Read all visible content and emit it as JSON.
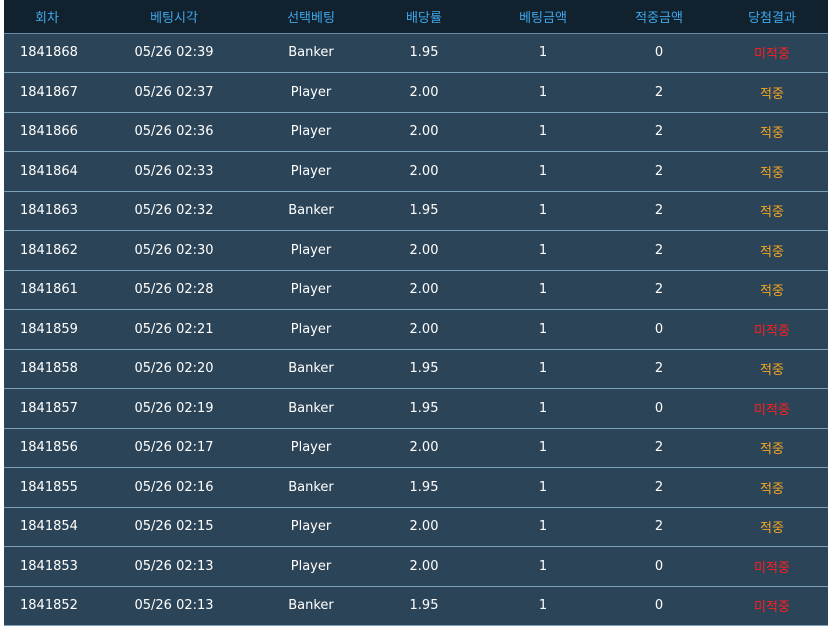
{
  "headers": [
    "회차",
    "베팅시각",
    "선택베팅",
    "배당률",
    "베팅금액",
    "적중금액",
    "당첨결과"
  ],
  "colors": {
    "header_bg": "#11212e",
    "header_text": "#3ea7ea",
    "row_bg": "#2c4457",
    "row_text": "#ffffff",
    "lose": "#ff1f1f",
    "win": "#f5a623"
  },
  "rows": [
    {
      "round": "1841868",
      "time": "05/26 02:39",
      "pick": "Banker",
      "odds": "1.95",
      "bet": "1",
      "payout": "0",
      "result": "미적중",
      "status": "lose"
    },
    {
      "round": "1841867",
      "time": "05/26 02:37",
      "pick": "Player",
      "odds": "2.00",
      "bet": "1",
      "payout": "2",
      "result": "적중",
      "status": "win"
    },
    {
      "round": "1841866",
      "time": "05/26 02:36",
      "pick": "Player",
      "odds": "2.00",
      "bet": "1",
      "payout": "2",
      "result": "적중",
      "status": "win"
    },
    {
      "round": "1841864",
      "time": "05/26 02:33",
      "pick": "Player",
      "odds": "2.00",
      "bet": "1",
      "payout": "2",
      "result": "적중",
      "status": "win"
    },
    {
      "round": "1841863",
      "time": "05/26 02:32",
      "pick": "Banker",
      "odds": "1.95",
      "bet": "1",
      "payout": "2",
      "result": "적중",
      "status": "win"
    },
    {
      "round": "1841862",
      "time": "05/26 02:30",
      "pick": "Player",
      "odds": "2.00",
      "bet": "1",
      "payout": "2",
      "result": "적중",
      "status": "win"
    },
    {
      "round": "1841861",
      "time": "05/26 02:28",
      "pick": "Player",
      "odds": "2.00",
      "bet": "1",
      "payout": "2",
      "result": "적중",
      "status": "win"
    },
    {
      "round": "1841859",
      "time": "05/26 02:21",
      "pick": "Player",
      "odds": "2.00",
      "bet": "1",
      "payout": "0",
      "result": "미적중",
      "status": "lose"
    },
    {
      "round": "1841858",
      "time": "05/26 02:20",
      "pick": "Banker",
      "odds": "1.95",
      "bet": "1",
      "payout": "2",
      "result": "적중",
      "status": "win"
    },
    {
      "round": "1841857",
      "time": "05/26 02:19",
      "pick": "Banker",
      "odds": "1.95",
      "bet": "1",
      "payout": "0",
      "result": "미적중",
      "status": "lose"
    },
    {
      "round": "1841856",
      "time": "05/26 02:17",
      "pick": "Player",
      "odds": "2.00",
      "bet": "1",
      "payout": "2",
      "result": "적중",
      "status": "win"
    },
    {
      "round": "1841855",
      "time": "05/26 02:16",
      "pick": "Banker",
      "odds": "1.95",
      "bet": "1",
      "payout": "2",
      "result": "적중",
      "status": "win"
    },
    {
      "round": "1841854",
      "time": "05/26 02:15",
      "pick": "Player",
      "odds": "2.00",
      "bet": "1",
      "payout": "2",
      "result": "적중",
      "status": "win"
    },
    {
      "round": "1841853",
      "time": "05/26 02:13",
      "pick": "Player",
      "odds": "2.00",
      "bet": "1",
      "payout": "0",
      "result": "미적중",
      "status": "lose"
    },
    {
      "round": "1841852",
      "time": "05/26 02:13",
      "pick": "Banker",
      "odds": "1.95",
      "bet": "1",
      "payout": "0",
      "result": "미적중",
      "status": "lose"
    }
  ]
}
